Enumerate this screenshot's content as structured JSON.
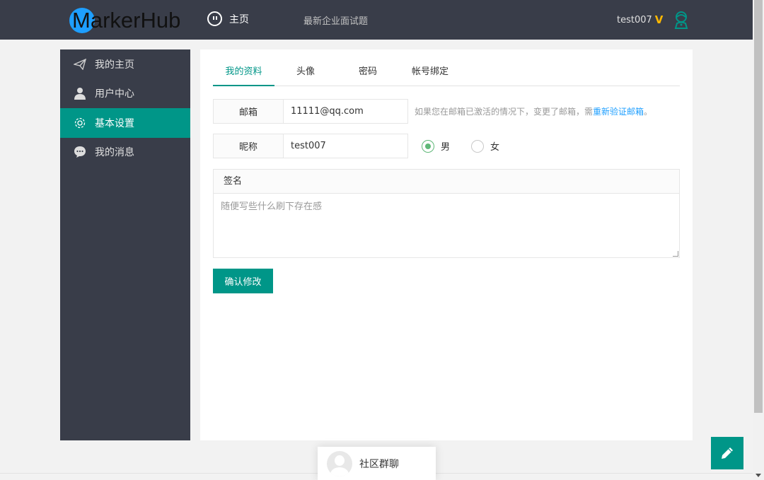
{
  "header": {
    "logo_text": "MarkerHub",
    "nav_home": "主页",
    "nav_interview": "最新企业面试题",
    "user_name": "test007",
    "vip_badge": "V",
    "accent_color": "#009688",
    "bg_color": "#393d49"
  },
  "sidebar": {
    "items": [
      {
        "label": "我的主页",
        "icon": "paper-plane-icon"
      },
      {
        "label": "用户中心",
        "icon": "user-icon"
      },
      {
        "label": "基本设置",
        "icon": "gear-icon",
        "active": true
      },
      {
        "label": "我的消息",
        "icon": "chat-bubble-icon"
      }
    ]
  },
  "tabs": [
    {
      "label": "我的资料",
      "active": true
    },
    {
      "label": "头像"
    },
    {
      "label": "密码"
    },
    {
      "label": "帐号绑定"
    }
  ],
  "form": {
    "email_label": "邮箱",
    "email_value": "11111@qq.com",
    "email_hint": "如果您在邮箱已激活的情况下，变更了邮箱，需",
    "email_hint_link": "重新验证邮箱",
    "email_hint_end": "。",
    "nickname_label": "昵称",
    "nickname_value": "test007",
    "gender_male": "男",
    "gender_female": "女",
    "gender_selected": "男",
    "sign_label": "签名",
    "sign_placeholder": "随便写些什么刷下存在感",
    "submit_label": "确认修改"
  },
  "footer": {
    "chat_label": "社区群聊"
  }
}
